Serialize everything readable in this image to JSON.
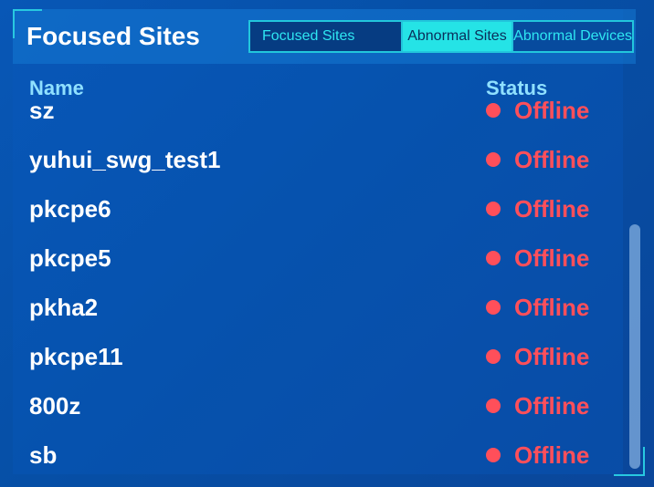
{
  "panel": {
    "title": "Focused Sites"
  },
  "tabs": [
    {
      "label": "Focused Sites",
      "active": false
    },
    {
      "label": "Abnormal Sites",
      "active": true
    },
    {
      "label": "Abnormal Devices",
      "active": false
    }
  ],
  "table": {
    "columns": [
      "Name",
      "Status"
    ],
    "rows": [
      {
        "name": "sz",
        "status": "Offline"
      },
      {
        "name": "yuhui_swg_test1",
        "status": "Offline"
      },
      {
        "name": "pkcpe6",
        "status": "Offline"
      },
      {
        "name": "pkcpe5",
        "status": "Offline"
      },
      {
        "name": "pkha2",
        "status": "Offline"
      },
      {
        "name": "pkcpe11",
        "status": "Offline"
      },
      {
        "name": "800z",
        "status": "Offline"
      },
      {
        "name": "sb",
        "status": "Offline"
      }
    ]
  },
  "colors": {
    "accent": "#25e3e6",
    "offline": "#ff4f5a",
    "header_text": "#8fe0ff"
  }
}
